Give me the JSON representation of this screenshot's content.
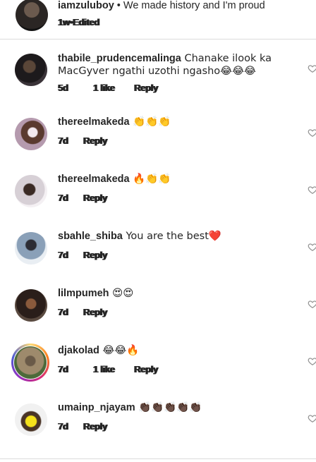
{
  "caption": {
    "username": "iamzuluboy",
    "separator": " • ",
    "text": "We made history and I'm proud",
    "time": "1w",
    "dot": " • ",
    "edited": "Edited"
  },
  "comments": [
    {
      "username": "thabile_prudencemalinga",
      "text": " Chanake ilook ka MacGyver  ngathi uzothi ngasho😂😂😂",
      "time": "5d",
      "likes": "1 like",
      "reply": "Reply"
    },
    {
      "username": "thereelmakeda",
      "text": " 👏👏👏",
      "time": "7d",
      "reply": "Reply"
    },
    {
      "username": "thereelmakeda",
      "text": " 🔥👏👏",
      "time": "7d",
      "reply": "Reply"
    },
    {
      "username": "sbahle_shiba",
      "text": " You are the best❤️",
      "time": "7d",
      "reply": "Reply"
    },
    {
      "username": "lilmpumeh",
      "text": " 😍😍",
      "time": "7d",
      "reply": "Reply"
    },
    {
      "username": "djakolad",
      "text": " 😂😂🔥",
      "time": "7d",
      "likes": "1 like",
      "reply": "Reply"
    },
    {
      "username": "umainp_njayam",
      "text": " 👏🏿👏🏿👏🏿👏🏿👏🏿",
      "time": "7d",
      "reply": "Reply"
    }
  ],
  "icons": {
    "like": "heart-outline-icon"
  },
  "colors": {
    "text": "#262626",
    "divider": "#dbdbdb",
    "heart": "#8e8e8e"
  }
}
